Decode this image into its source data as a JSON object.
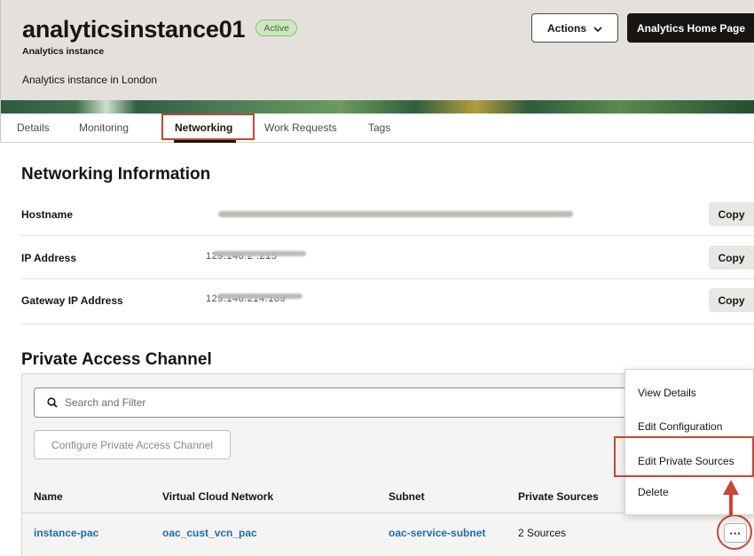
{
  "header": {
    "title": "analyticsinstance01",
    "status": "Active",
    "subtitle": "Analytics instance",
    "description": "Analytics instance in London",
    "actions_label": "Actions",
    "home_label": "Analytics Home Page"
  },
  "tabs": [
    {
      "label": "Details"
    },
    {
      "label": "Monitoring"
    },
    {
      "label": "Networking"
    },
    {
      "label": "Work Requests"
    },
    {
      "label": "Tags"
    }
  ],
  "networking": {
    "title": "Networking Information",
    "rows": [
      {
        "label": "Hostname",
        "value": "",
        "copy": "Copy"
      },
      {
        "label": "IP Address",
        "value": "129.146.2 .215",
        "copy": "Copy"
      },
      {
        "label": "Gateway IP Address",
        "value": "129.146.214.189",
        "copy": "Copy"
      }
    ]
  },
  "pac": {
    "title": "Private Access Channel",
    "search_placeholder": "Search and Filter",
    "configure_label": "Configure Private Access Channel",
    "columns": [
      "Name",
      "Virtual Cloud Network",
      "Subnet",
      "Private Sources"
    ],
    "row": {
      "name": "instance-pac",
      "vcn": "oac_cust_vcn_pac",
      "subnet": "oac-service-subnet",
      "sources": "2 Sources"
    },
    "more_label": "···"
  },
  "menu": {
    "items": [
      {
        "label": "View Details"
      },
      {
        "label": "Edit Configuration"
      },
      {
        "label": "Edit Private Sources"
      },
      {
        "label": "Delete"
      }
    ]
  },
  "colors": {
    "highlight": "#c74634",
    "link": "#1b6ea9",
    "badge_bg": "#cfe6c3"
  }
}
